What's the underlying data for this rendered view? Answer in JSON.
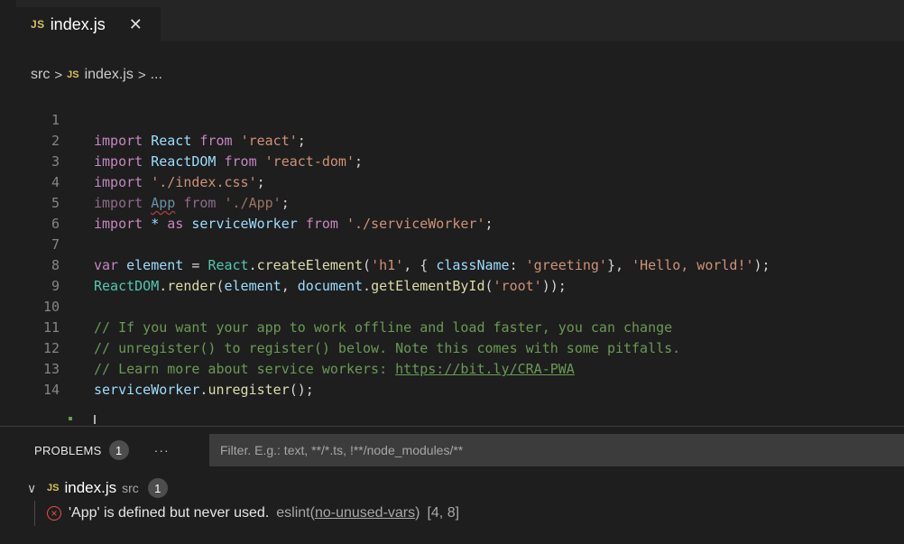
{
  "tab": {
    "badge": "JS",
    "label": "index.js",
    "close": "✕"
  },
  "breadcrumb": {
    "folder": "src",
    "sep1": ">",
    "badge": "JS",
    "file": "index.js",
    "sep2": ">",
    "more": "..."
  },
  "code": {
    "lines": [
      {
        "n": "1"
      },
      {
        "n": "2"
      },
      {
        "n": "3"
      },
      {
        "n": "4"
      },
      {
        "n": "5"
      },
      {
        "n": "6"
      },
      {
        "n": "7"
      },
      {
        "n": "8"
      },
      {
        "n": "9"
      },
      {
        "n": "10"
      },
      {
        "n": "11"
      },
      {
        "n": "12"
      },
      {
        "n": "13"
      },
      {
        "n": "14"
      }
    ],
    "l1": [
      "import",
      " ",
      "React",
      " ",
      "from",
      " ",
      "'react'",
      ";"
    ],
    "l2": [
      "import",
      " ",
      "ReactDOM",
      " ",
      "from",
      " ",
      "'react-dom'",
      ";"
    ],
    "l3": [
      "import",
      " ",
      "'./index.css'",
      ";"
    ],
    "l4": [
      "import",
      " ",
      "App",
      " ",
      "from",
      " ",
      "'./App'",
      ";"
    ],
    "l5": [
      "import",
      " * ",
      "as",
      " ",
      "serviceWorker",
      " ",
      "from",
      " ",
      "'./serviceWorker'",
      ";"
    ],
    "l7": [
      "var",
      " ",
      "element",
      " = ",
      "React",
      ".",
      "createElement",
      "(",
      "'h1'",
      ", { ",
      "className",
      ": ",
      "'greeting'",
      "}, ",
      "'Hello, world!'",
      ");"
    ],
    "l8": [
      "ReactDOM",
      ".",
      "render",
      "(",
      "element",
      ", ",
      "document",
      ".",
      "getElementById",
      "(",
      "'root'",
      "));"
    ],
    "l10": "// If you want your app to work offline and load faster, you can change",
    "l11": "// unregister() to register() below. Note this comes with some pitfalls.",
    "l12a": "// Learn more about service workers: ",
    "l12b": "https://bit.ly/CRA-PWA",
    "l13": [
      "serviceWorker",
      ".",
      "unregister",
      "();"
    ]
  },
  "panel": {
    "problems_label": "PROBLEMS",
    "problems_count": "1",
    "more": "···",
    "filter_placeholder": "Filter. E.g.: text, **/*.ts, !**/node_modules/**",
    "file": {
      "chevron": "∨",
      "badge": "JS",
      "name": "index.js",
      "dir": "src",
      "count": "1"
    },
    "problem": {
      "icon": "×",
      "message": "'App' is defined but never used.",
      "source_prefix": "eslint(",
      "source_code": "no-unused-vars",
      "source_suffix": ")",
      "location": "[4, 8]"
    }
  },
  "colors": {
    "background": "#1e1e1e",
    "keyword": "#c586c0",
    "variable": "#9cdcfe",
    "class": "#4ec9b0",
    "function": "#dcdcaa",
    "string": "#ce9178",
    "comment": "#6a9955",
    "error": "#f14c4c",
    "js_badge": "#d7c15a"
  }
}
